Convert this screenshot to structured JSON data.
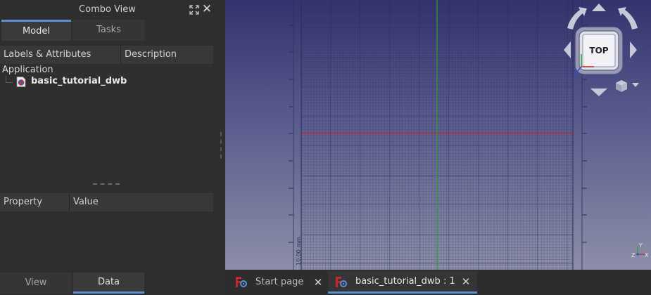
{
  "combo_view": {
    "title": "Combo View",
    "tabs_top": {
      "model": "Model",
      "tasks": "Tasks"
    },
    "tree": {
      "headers": {
        "labels": "Labels & Attributes",
        "description": "Description"
      },
      "root_label": "Application",
      "document_label": "basic_tutorial_dwb"
    },
    "properties": {
      "headers": {
        "property": "Property",
        "value": "Value"
      }
    },
    "tabs_bottom": {
      "view": "View",
      "data": "Data"
    }
  },
  "viewport": {
    "navcube_face": "TOP",
    "ruler_label": "10.00 mm",
    "axis_labels": {
      "x": "X",
      "y": "Y",
      "z": "Z"
    },
    "colors": {
      "x_axis": "#c0282a",
      "y_axis": "#1ea82a",
      "accent": "#5b8fd6"
    }
  },
  "document_tabs": [
    {
      "label": "Start page"
    },
    {
      "label": "basic_tutorial_dwb : 1"
    }
  ]
}
